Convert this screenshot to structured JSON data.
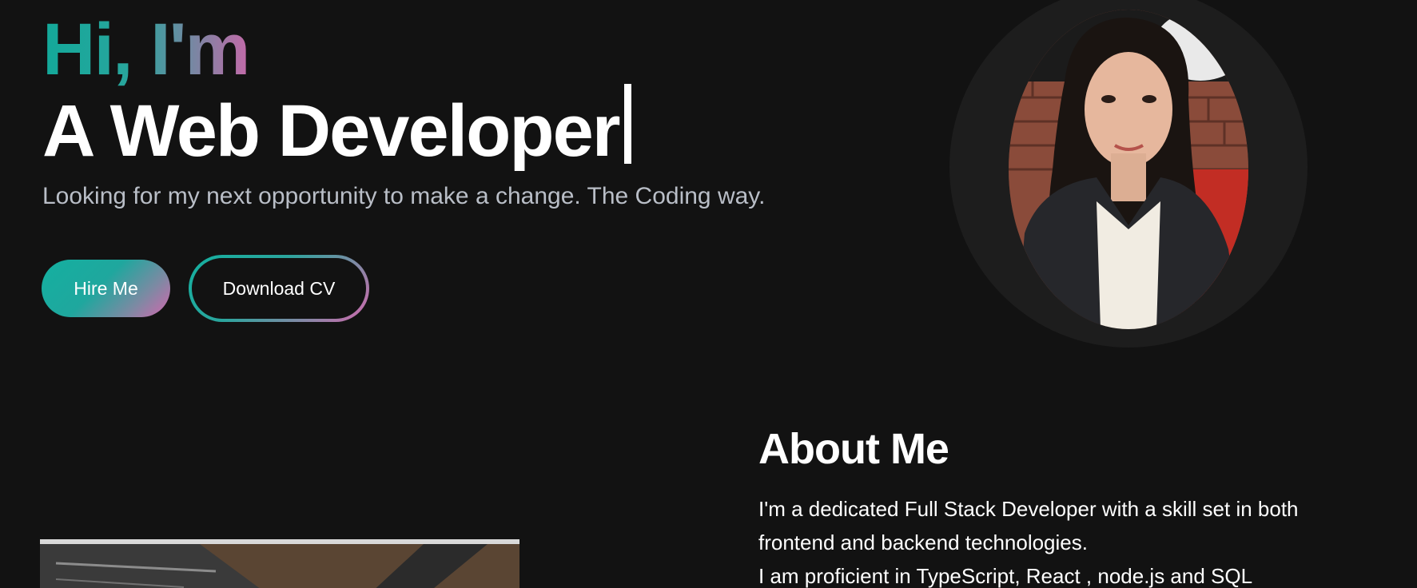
{
  "hero": {
    "greeting": "Hi, I'm",
    "role": "A Web Developer",
    "tagline": "Looking for my next opportunity to make a change. The Coding way.",
    "buttons": {
      "hire": "Hire Me",
      "download_cv": "Download CV"
    }
  },
  "about": {
    "title": "About Me",
    "lines": [
      "I'm a dedicated Full Stack Developer with a skill set in both",
      "frontend and backend technologies.",
      "I am proficient in TypeScript, React , node.js and SQL"
    ]
  },
  "colors": {
    "background": "#121212",
    "accent_teal": "#13a99a",
    "accent_pink": "#d367ae",
    "muted_text": "#b9bec7"
  }
}
